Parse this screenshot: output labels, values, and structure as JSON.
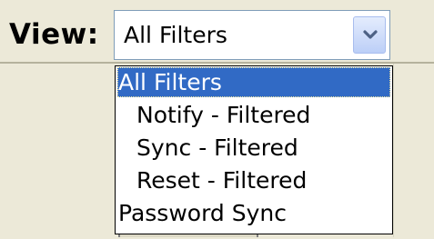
{
  "view_label": "View:",
  "combo": {
    "selected_value": "All Filters",
    "button_icon": "chevron-down-icon"
  },
  "dropdown": {
    "items": [
      {
        "label": "All Filters",
        "selected": true,
        "indent": 0
      },
      {
        "label": "Notify - Filtered",
        "selected": false,
        "indent": 1
      },
      {
        "label": "Sync - Filtered",
        "selected": false,
        "indent": 1
      },
      {
        "label": "Reset - Filtered",
        "selected": false,
        "indent": 1
      },
      {
        "label": "Password Sync",
        "selected": false,
        "indent": 0
      }
    ]
  },
  "colors": {
    "selection_highlight": "#316ac5",
    "background": "#ece9d8",
    "combo_border": "#7f9db9"
  }
}
